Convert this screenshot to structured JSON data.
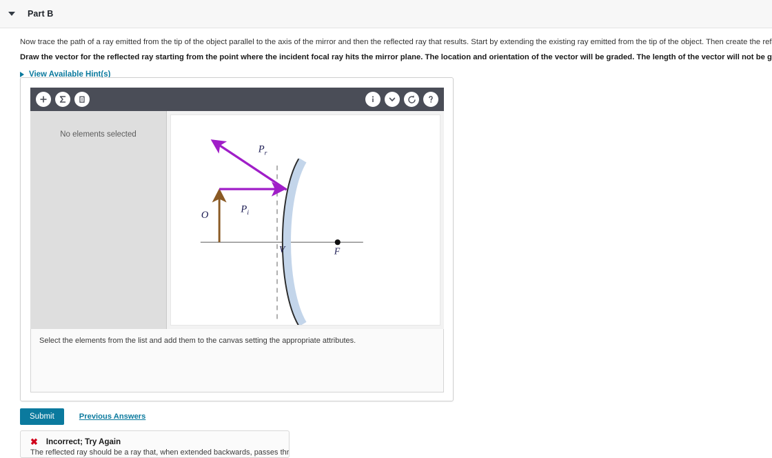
{
  "header": {
    "part_title": "Part B",
    "collapse_icon": "triangle-down-icon"
  },
  "prompt": {
    "line1": "Now trace the path of a ray emitted from the tip of the object parallel to the axis of the mirror and then the reflected ray that results. Start by extending the existing ray emitted from the tip of the object. Then create the reflected ray.",
    "line2": "Draw the vector for the reflected ray starting from the point where the incident focal ray hits the mirror plane. The location and orientation of the vector will be graded. The length of the vector will not be graded.",
    "hints_label": "View Available Hint(s)"
  },
  "widget": {
    "toolbar": {
      "left_buttons": [
        {
          "name": "add-element-button",
          "icon": "plus-icon",
          "glyph": "+"
        },
        {
          "name": "sum-element-button",
          "icon": "sigma-icon",
          "glyph": "Σ"
        },
        {
          "name": "delete-element-button",
          "icon": "trash-icon",
          "glyph": "Ὕ1"
        }
      ],
      "right_buttons": [
        {
          "name": "info-button",
          "icon": "info-icon",
          "glyph": "i"
        },
        {
          "name": "dropdown-button",
          "icon": "chevron-down-icon",
          "glyph": "⌄"
        },
        {
          "name": "undo-button",
          "icon": "undo-icon",
          "glyph": "↺"
        },
        {
          "name": "help-button",
          "icon": "question-mark-icon",
          "glyph": "?"
        }
      ]
    },
    "element_panel": {
      "empty_text": "No elements selected"
    },
    "hint_text": "Select the elements from the list and add them to the canvas setting the appropriate attributes."
  },
  "diagram": {
    "labels": {
      "object": "O",
      "incident_ray": "P",
      "incident_ray_sub": "i",
      "reflected_ray": "P",
      "reflected_ray_sub": "r",
      "vertex": "V",
      "focus": "F"
    },
    "colors": {
      "ray": "#a01ec8",
      "object": "#8a5a24",
      "mirror_fill": "#c3d5ea",
      "mirror_stroke": "#2b2b2b",
      "axis": "#6b6b6b",
      "dashed": "#9a9a9a"
    }
  },
  "actions": {
    "submit_label": "Submit",
    "previous_answers_label": "Previous Answers"
  },
  "feedback": {
    "x_icon": "error-x-icon",
    "title": "Incorrect; Try Again",
    "body": "The reflected ray should be a ray that, when extended backwards, passes through the focal point."
  }
}
